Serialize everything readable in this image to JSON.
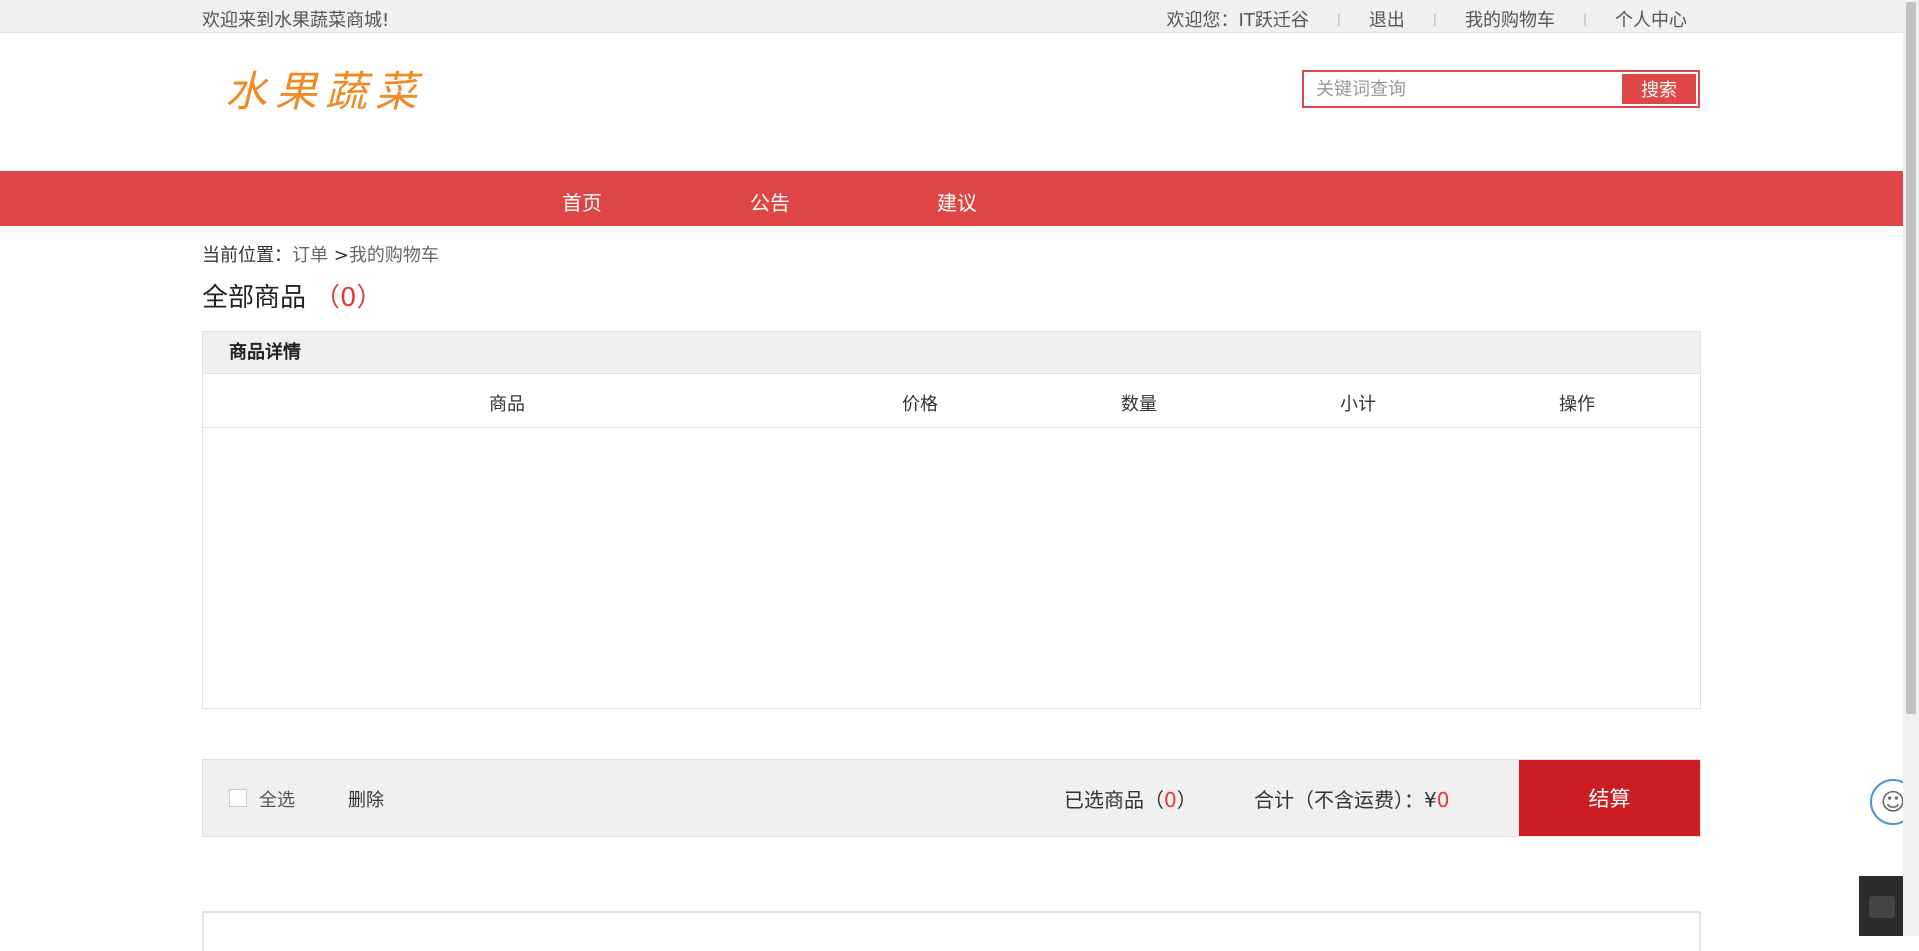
{
  "topbar": {
    "welcome": "欢迎来到水果蔬菜商城!",
    "user": "欢迎您：IT跃迁谷",
    "logout": "退出",
    "my_cart": "我的购物车",
    "profile": "个人中心"
  },
  "header": {
    "logo": "水果蔬菜",
    "search_placeholder": "关键词查询",
    "search_button": "搜索"
  },
  "nav": {
    "items": [
      "首页",
      "公告",
      "建议"
    ]
  },
  "breadcrumb": {
    "prefix": "当前位置：",
    "order": "订单",
    "separator": ">",
    "current": "我的购物车"
  },
  "cart": {
    "title": "全部商品",
    "count": "（0）",
    "section_header": "商品详情",
    "columns": [
      "商品",
      "价格",
      "数量",
      "小计",
      "操作"
    ]
  },
  "summary": {
    "select_all": "全选",
    "delete": "删除",
    "selected_label": "已选商品（",
    "selected_count": "0",
    "selected_close": "）",
    "total_label": "合计（不含运费）：",
    "currency": "¥",
    "total_value": "0",
    "checkout": "结算"
  },
  "colors": {
    "brand_red": "#df4545",
    "checkout_red": "#cb1d22",
    "logo_orange": "#f08a24"
  }
}
